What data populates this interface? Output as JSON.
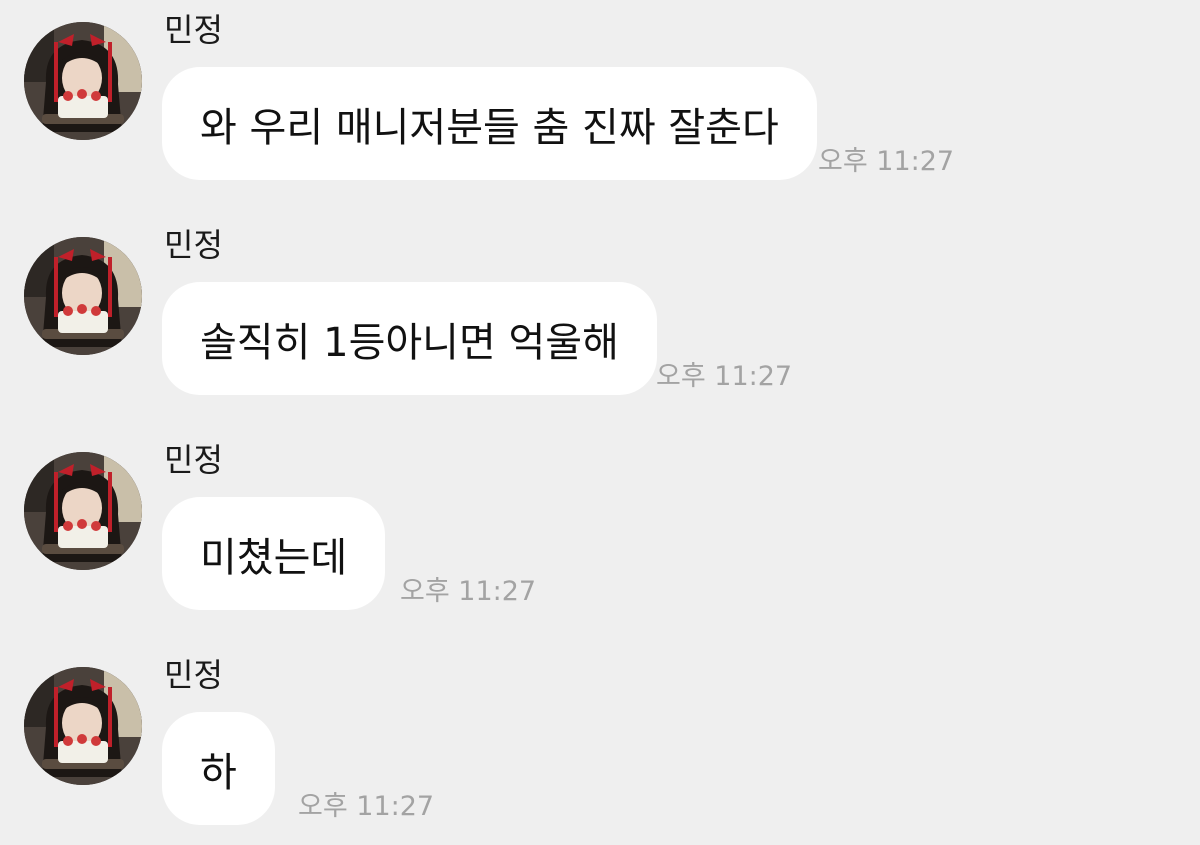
{
  "messages": [
    {
      "sender": "민정",
      "text": "와 우리 매니저분들 춤 진짜 잘춘다",
      "time": "오후 11:27",
      "avatar": "profile-photo"
    },
    {
      "sender": "민정",
      "text": "솔직히 1등아니면 억울해",
      "time": "오후 11:27",
      "avatar": "profile-photo"
    },
    {
      "sender": "민정",
      "text": "미쳤는데",
      "time": "오후 11:27",
      "avatar": "profile-photo"
    },
    {
      "sender": "민정",
      "text": "하",
      "time": "오후 11:27",
      "avatar": "profile-photo"
    }
  ],
  "colors": {
    "background": "#efefef",
    "bubble": "#ffffff",
    "timestamp": "#a3a3a3",
    "ribbon": "#c0202a"
  }
}
